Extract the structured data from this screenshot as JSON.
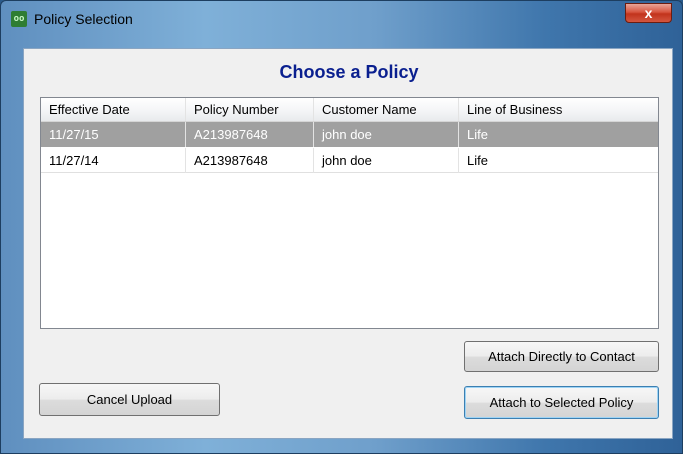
{
  "window": {
    "title": "Policy Selection",
    "icon": "app-logo-icon",
    "icon_glyph": "oo",
    "close_glyph": "x"
  },
  "heading": "Choose a Policy",
  "table": {
    "columns": [
      "Effective Date",
      "Policy Number",
      "Customer Name",
      "Line of Business"
    ],
    "rows": [
      {
        "effective_date": "11/27/15",
        "policy_number": "A213987648",
        "customer_name": "john doe",
        "line_of_business": "Life",
        "selected": true
      },
      {
        "effective_date": "11/27/14",
        "policy_number": "A213987648",
        "customer_name": "john doe",
        "line_of_business": "Life",
        "selected": false
      }
    ]
  },
  "buttons": {
    "attach_contact": "Attach Directly to Contact",
    "cancel_upload": "Cancel Upload",
    "attach_policy": "Attach to Selected Policy"
  },
  "colors": {
    "heading": "#0a1f8f",
    "selected_row": "#a0a0a0",
    "close_button": "#c2331c"
  }
}
